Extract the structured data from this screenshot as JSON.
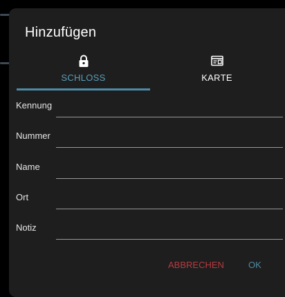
{
  "dialog": {
    "title": "Hinzufügen",
    "tabs": [
      {
        "label": "SCHLOSS",
        "icon": "lock-icon",
        "active": true
      },
      {
        "label": "KARTE",
        "icon": "id-card-icon",
        "active": false
      }
    ],
    "fields": [
      {
        "label": "Kennung",
        "value": "",
        "placeholder": ""
      },
      {
        "label": "Nummer",
        "value": "",
        "placeholder": ""
      },
      {
        "label": "Name",
        "value": "",
        "placeholder": ""
      },
      {
        "label": "Ort",
        "value": "",
        "placeholder": ""
      },
      {
        "label": "Notiz",
        "value": "",
        "placeholder": ""
      }
    ],
    "actions": {
      "cancel_label": "ABBRECHEN",
      "ok_label": "OK"
    }
  },
  "colors": {
    "dialog_background": "#1e1e1e",
    "accent": "#4e8ca6",
    "active_tab_text": "#5a9fbc",
    "cancel": "#b83a3f",
    "text": "#ffffff"
  }
}
